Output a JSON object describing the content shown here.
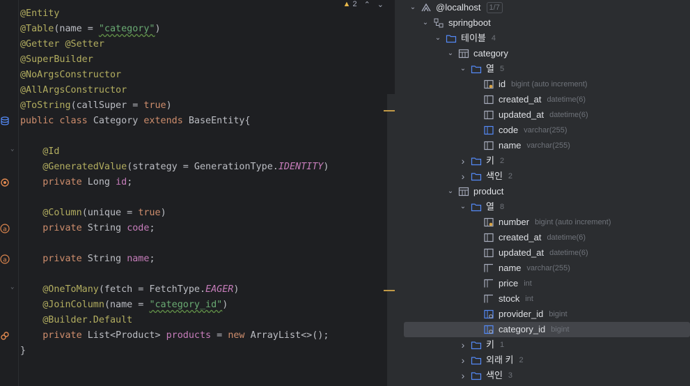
{
  "editor": {
    "warning_count": "2",
    "lines": [
      {
        "segs": [
          [
            "ann",
            "@Entity"
          ]
        ]
      },
      {
        "segs": [
          [
            "ann",
            "@Table"
          ],
          [
            "",
            "(name = "
          ],
          [
            "str wavy",
            "\"category\""
          ],
          [
            "",
            ")"
          ]
        ]
      },
      {
        "segs": [
          [
            "ann",
            "@Getter @Setter"
          ]
        ]
      },
      {
        "segs": [
          [
            "ann",
            "@SuperBuilder"
          ]
        ]
      },
      {
        "segs": [
          [
            "ann",
            "@NoArgsConstructor"
          ]
        ]
      },
      {
        "segs": [
          [
            "ann",
            "@AllArgsConstructor"
          ]
        ]
      },
      {
        "segs": [
          [
            "ann",
            "@ToString"
          ],
          [
            "",
            "(callSuper = "
          ],
          [
            "kw",
            "true"
          ],
          [
            "",
            ")"
          ]
        ]
      },
      {
        "segs": [
          [
            "kw",
            "public class "
          ],
          [
            "",
            "Category "
          ],
          [
            "kw",
            "extends "
          ],
          [
            "",
            "BaseEntity{"
          ]
        ]
      },
      {
        "segs": []
      },
      {
        "segs": [
          [
            "",
            "    "
          ],
          [
            "ann",
            "@Id"
          ]
        ]
      },
      {
        "segs": [
          [
            "",
            "    "
          ],
          [
            "ann",
            "@GeneratedValue"
          ],
          [
            "",
            "(strategy = GenerationType."
          ],
          [
            "const",
            "IDENTITY"
          ],
          [
            "",
            ")"
          ]
        ]
      },
      {
        "segs": [
          [
            "",
            "    "
          ],
          [
            "kw",
            "private "
          ],
          [
            "",
            "Long "
          ],
          [
            "fld",
            "id"
          ],
          [
            "",
            ";"
          ]
        ]
      },
      {
        "segs": []
      },
      {
        "segs": [
          [
            "",
            "    "
          ],
          [
            "ann",
            "@Column"
          ],
          [
            "",
            "(unique = "
          ],
          [
            "kw",
            "true"
          ],
          [
            "",
            ")"
          ]
        ]
      },
      {
        "segs": [
          [
            "",
            "    "
          ],
          [
            "kw",
            "private "
          ],
          [
            "",
            "String "
          ],
          [
            "fld",
            "code"
          ],
          [
            "",
            ";"
          ]
        ]
      },
      {
        "segs": []
      },
      {
        "segs": [
          [
            "",
            "    "
          ],
          [
            "kw",
            "private "
          ],
          [
            "",
            "String "
          ],
          [
            "fld",
            "name"
          ],
          [
            "",
            ";"
          ]
        ]
      },
      {
        "segs": []
      },
      {
        "segs": [
          [
            "",
            "    "
          ],
          [
            "ann",
            "@OneToMany"
          ],
          [
            "",
            "(fetch = FetchType."
          ],
          [
            "const",
            "EAGER"
          ],
          [
            "",
            ")"
          ]
        ]
      },
      {
        "segs": [
          [
            "",
            "    "
          ],
          [
            "ann",
            "@JoinColumn"
          ],
          [
            "",
            "(name = "
          ],
          [
            "str wavy",
            "\"category_id\""
          ],
          [
            "",
            ")"
          ]
        ]
      },
      {
        "segs": [
          [
            "",
            "    "
          ],
          [
            "ann",
            "@Builder.Default"
          ]
        ]
      },
      {
        "segs": [
          [
            "",
            "    "
          ],
          [
            "kw",
            "private "
          ],
          [
            "",
            "List<Product> "
          ],
          [
            "fld",
            "products"
          ],
          [
            "",
            " = "
          ],
          [
            "kw",
            "new "
          ],
          [
            "",
            "ArrayList<>();"
          ]
        ]
      },
      {
        "segs": [
          [
            "",
            "}"
          ]
        ]
      }
    ]
  },
  "tree": [
    {
      "label": "@localhost",
      "meta": "1/7",
      "icon": "datasource-icon",
      "chev": "open",
      "meta_box": true
    },
    {
      "label": "springboot",
      "meta": "",
      "icon": "schema-icon",
      "chev": "open"
    },
    {
      "label": "테이블",
      "meta": "4",
      "icon": "folder-icon",
      "chev": "open"
    },
    {
      "label": "category",
      "meta": "",
      "icon": "table-icon",
      "chev": "open"
    },
    {
      "label": "열",
      "meta": "5",
      "icon": "folder-icon",
      "chev": "open"
    },
    {
      "label": "id",
      "meta": "bigint (auto increment)",
      "icon": "pk-column-icon",
      "chev": ""
    },
    {
      "label": "created_at",
      "meta": "datetime(6)",
      "icon": "column-icon",
      "chev": ""
    },
    {
      "label": "updated_at",
      "meta": "datetime(6)",
      "icon": "column-icon",
      "chev": ""
    },
    {
      "label": "code",
      "meta": "varchar(255)",
      "icon": "index-column-icon",
      "chev": ""
    },
    {
      "label": "name",
      "meta": "varchar(255)",
      "icon": "column-icon",
      "chev": ""
    },
    {
      "label": "키",
      "meta": "2",
      "icon": "folder-icon",
      "chev": "closed"
    },
    {
      "label": "색인",
      "meta": "2",
      "icon": "folder-icon",
      "chev": "closed"
    },
    {
      "label": "product",
      "meta": "",
      "icon": "table-icon",
      "chev": "open"
    },
    {
      "label": "열",
      "meta": "8",
      "icon": "folder-icon",
      "chev": "open"
    },
    {
      "label": "number",
      "meta": "bigint (auto increment)",
      "icon": "pk-column-icon",
      "chev": ""
    },
    {
      "label": "created_at",
      "meta": "datetime(6)",
      "icon": "column-icon",
      "chev": ""
    },
    {
      "label": "updated_at",
      "meta": "datetime(6)",
      "icon": "column-icon",
      "chev": ""
    },
    {
      "label": "name",
      "meta": "varchar(255)",
      "icon": "notnull-column-icon",
      "chev": ""
    },
    {
      "label": "price",
      "meta": "int",
      "icon": "notnull-column-icon",
      "chev": ""
    },
    {
      "label": "stock",
      "meta": "int",
      "icon": "notnull-column-icon",
      "chev": ""
    },
    {
      "label": "provider_id",
      "meta": "bigint",
      "icon": "fk-column-icon",
      "chev": ""
    },
    {
      "label": "category_id",
      "meta": "bigint",
      "icon": "fk-column-icon",
      "chev": "",
      "selected": true
    },
    {
      "label": "키",
      "meta": "1",
      "icon": "folder-icon",
      "chev": "closed"
    },
    {
      "label": "외래 키",
      "meta": "2",
      "icon": "folder-icon",
      "chev": "closed"
    },
    {
      "label": "색인",
      "meta": "3",
      "icon": "folder-icon",
      "chev": "closed"
    }
  ]
}
